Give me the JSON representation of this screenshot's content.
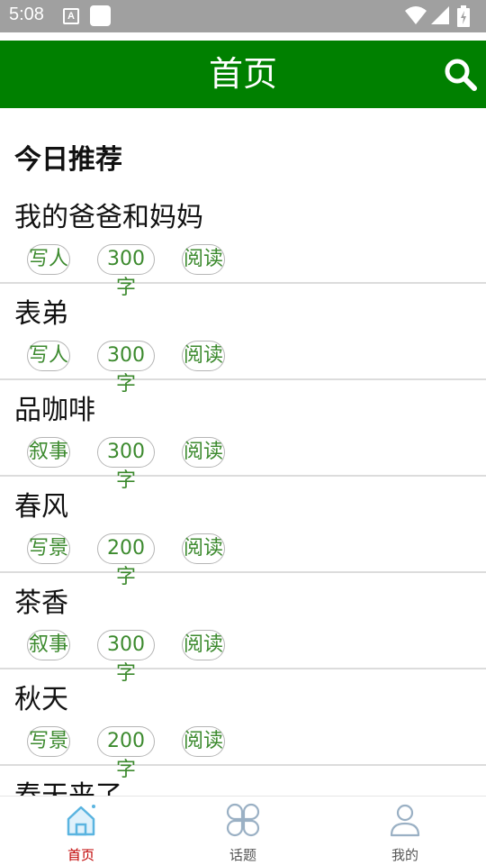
{
  "status_bar": {
    "time": "5:08",
    "a_icon_letter": "A"
  },
  "header": {
    "title": "首页"
  },
  "section": {
    "title": "今日推荐"
  },
  "articles": [
    {
      "title": "我的爸爸和妈妈",
      "type": "写人",
      "count": "300字",
      "read": "阅读"
    },
    {
      "title": "表弟",
      "type": "写人",
      "count": "300字",
      "read": "阅读"
    },
    {
      "title": "品咖啡",
      "type": "叙事",
      "count": "300字",
      "read": "阅读"
    },
    {
      "title": "春风",
      "type": "写景",
      "count": "200字",
      "read": "阅读"
    },
    {
      "title": "茶香",
      "type": "叙事",
      "count": "300字",
      "read": "阅读"
    },
    {
      "title": "秋天",
      "type": "写景",
      "count": "200字",
      "read": "阅读"
    },
    {
      "title": "春天来了"
    }
  ],
  "nav": {
    "home": "首页",
    "topics": "话题",
    "mine": "我的"
  },
  "colors": {
    "header_bg": "#008000",
    "tag_text": "#3c8a2e",
    "nav_active": "#c00000",
    "home_icon": "#5ab4e0",
    "nav_icon": "#9ab0c4"
  },
  "icons": [
    "search-icon",
    "home-icon",
    "topics-icon",
    "profile-icon",
    "wifi-icon",
    "signal-icon",
    "battery-icon"
  ]
}
